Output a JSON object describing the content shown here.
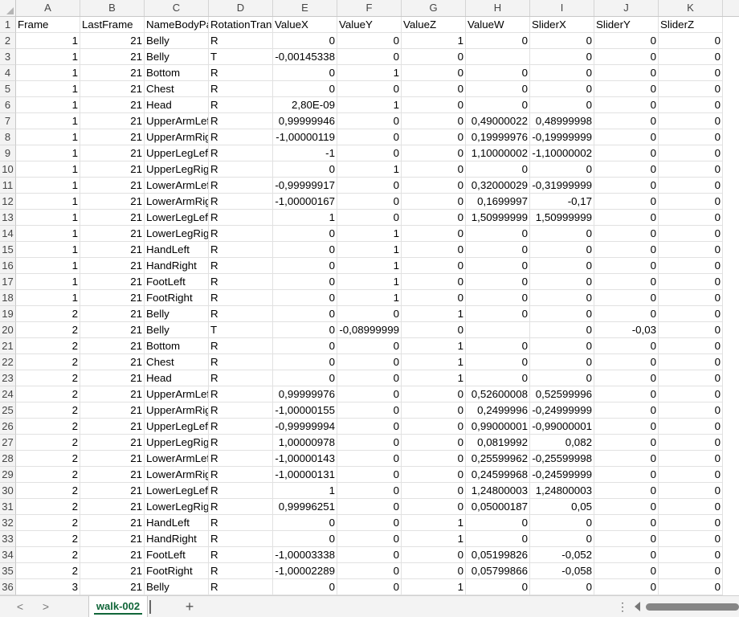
{
  "columns": [
    {
      "letter": "A"
    },
    {
      "letter": "B"
    },
    {
      "letter": "C"
    },
    {
      "letter": "D"
    },
    {
      "letter": "E"
    },
    {
      "letter": "F"
    },
    {
      "letter": "G"
    },
    {
      "letter": "H"
    },
    {
      "letter": "I"
    },
    {
      "letter": "J"
    },
    {
      "letter": "K"
    }
  ],
  "rows": [
    {
      "n": "1",
      "c": [
        "Frame",
        "LastFrame",
        "NameBodyPart",
        "RotationTranslation",
        "ValueX",
        "ValueY",
        "ValueZ",
        "ValueW",
        "SliderX",
        "SliderY",
        "SliderZ"
      ]
    },
    {
      "n": "2",
      "c": [
        "1",
        "21",
        "Belly",
        "R",
        "0",
        "0",
        "1",
        "0",
        "0",
        "0",
        "0"
      ]
    },
    {
      "n": "3",
      "c": [
        "1",
        "21",
        "Belly",
        "T",
        "-0,00145338",
        "0",
        "0",
        "",
        "0",
        "0",
        "0"
      ]
    },
    {
      "n": "4",
      "c": [
        "1",
        "21",
        "Bottom",
        "R",
        "0",
        "1",
        "0",
        "0",
        "0",
        "0",
        "0"
      ]
    },
    {
      "n": "5",
      "c": [
        "1",
        "21",
        "Chest",
        "R",
        "0",
        "0",
        "0",
        "0",
        "0",
        "0",
        "0"
      ]
    },
    {
      "n": "6",
      "c": [
        "1",
        "21",
        "Head",
        "R",
        "2,80E-09",
        "1",
        "0",
        "0",
        "0",
        "0",
        "0"
      ]
    },
    {
      "n": "7",
      "c": [
        "1",
        "21",
        "UpperArmLeft",
        "R",
        "0,99999946",
        "0",
        "0",
        "0,49000022",
        "0,48999998",
        "0",
        "0"
      ]
    },
    {
      "n": "8",
      "c": [
        "1",
        "21",
        "UpperArmRight",
        "R",
        "-1,00000119",
        "0",
        "0",
        "0,19999976",
        "-0,19999999",
        "0",
        "0"
      ]
    },
    {
      "n": "9",
      "c": [
        "1",
        "21",
        "UpperLegLeft",
        "R",
        "-1",
        "0",
        "0",
        "1,10000002",
        "-1,10000002",
        "0",
        "0"
      ]
    },
    {
      "n": "10",
      "c": [
        "1",
        "21",
        "UpperLegRight",
        "R",
        "0",
        "1",
        "0",
        "0",
        "0",
        "0",
        "0"
      ]
    },
    {
      "n": "11",
      "c": [
        "1",
        "21",
        "LowerArmLeft",
        "R",
        "-0,99999917",
        "0",
        "0",
        "0,32000029",
        "-0,31999999",
        "0",
        "0"
      ]
    },
    {
      "n": "12",
      "c": [
        "1",
        "21",
        "LowerArmRight",
        "R",
        "-1,00000167",
        "0",
        "0",
        "0,1699997",
        "-0,17",
        "0",
        "0"
      ]
    },
    {
      "n": "13",
      "c": [
        "1",
        "21",
        "LowerLegLeft",
        "R",
        "1",
        "0",
        "0",
        "1,50999999",
        "1,50999999",
        "0",
        "0"
      ]
    },
    {
      "n": "14",
      "c": [
        "1",
        "21",
        "LowerLegRight",
        "R",
        "0",
        "1",
        "0",
        "0",
        "0",
        "0",
        "0"
      ]
    },
    {
      "n": "15",
      "c": [
        "1",
        "21",
        "HandLeft",
        "R",
        "0",
        "1",
        "0",
        "0",
        "0",
        "0",
        "0"
      ]
    },
    {
      "n": "16",
      "c": [
        "1",
        "21",
        "HandRight",
        "R",
        "0",
        "1",
        "0",
        "0",
        "0",
        "0",
        "0"
      ]
    },
    {
      "n": "17",
      "c": [
        "1",
        "21",
        "FootLeft",
        "R",
        "0",
        "1",
        "0",
        "0",
        "0",
        "0",
        "0"
      ]
    },
    {
      "n": "18",
      "c": [
        "1",
        "21",
        "FootRight",
        "R",
        "0",
        "1",
        "0",
        "0",
        "0",
        "0",
        "0"
      ]
    },
    {
      "n": "19",
      "c": [
        "2",
        "21",
        "Belly",
        "R",
        "0",
        "0",
        "1",
        "0",
        "0",
        "0",
        "0"
      ]
    },
    {
      "n": "20",
      "c": [
        "2",
        "21",
        "Belly",
        "T",
        "0",
        "-0,08999999",
        "0",
        "",
        "0",
        "-0,03",
        "0"
      ]
    },
    {
      "n": "21",
      "c": [
        "2",
        "21",
        "Bottom",
        "R",
        "0",
        "0",
        "1",
        "0",
        "0",
        "0",
        "0"
      ]
    },
    {
      "n": "22",
      "c": [
        "2",
        "21",
        "Chest",
        "R",
        "0",
        "0",
        "1",
        "0",
        "0",
        "0",
        "0"
      ]
    },
    {
      "n": "23",
      "c": [
        "2",
        "21",
        "Head",
        "R",
        "0",
        "0",
        "1",
        "0",
        "0",
        "0",
        "0"
      ]
    },
    {
      "n": "24",
      "c": [
        "2",
        "21",
        "UpperArmLeft",
        "R",
        "0,99999976",
        "0",
        "0",
        "0,52600008",
        "0,52599996",
        "0",
        "0"
      ]
    },
    {
      "n": "25",
      "c": [
        "2",
        "21",
        "UpperArmRight",
        "R",
        "-1,00000155",
        "0",
        "0",
        "0,2499996",
        "-0,24999999",
        "0",
        "0"
      ]
    },
    {
      "n": "26",
      "c": [
        "2",
        "21",
        "UpperLegLeft",
        "R",
        "-0,99999994",
        "0",
        "0",
        "0,99000001",
        "-0,99000001",
        "0",
        "0"
      ]
    },
    {
      "n": "27",
      "c": [
        "2",
        "21",
        "UpperLegRight",
        "R",
        "1,00000978",
        "0",
        "0",
        "0,0819992",
        "0,082",
        "0",
        "0"
      ]
    },
    {
      "n": "28",
      "c": [
        "2",
        "21",
        "LowerArmLeft",
        "R",
        "-1,00000143",
        "0",
        "0",
        "0,25599962",
        "-0,25599998",
        "0",
        "0"
      ]
    },
    {
      "n": "29",
      "c": [
        "2",
        "21",
        "LowerArmRight",
        "R",
        "-1,00000131",
        "0",
        "0",
        "0,24599968",
        "-0,24599999",
        "0",
        "0"
      ]
    },
    {
      "n": "30",
      "c": [
        "2",
        "21",
        "LowerLegLeft",
        "R",
        "1",
        "0",
        "0",
        "1,24800003",
        "1,24800003",
        "0",
        "0"
      ]
    },
    {
      "n": "31",
      "c": [
        "2",
        "21",
        "LowerLegRight",
        "R",
        "0,99996251",
        "0",
        "0",
        "0,05000187",
        "0,05",
        "0",
        "0"
      ]
    },
    {
      "n": "32",
      "c": [
        "2",
        "21",
        "HandLeft",
        "R",
        "0",
        "0",
        "1",
        "0",
        "0",
        "0",
        "0"
      ]
    },
    {
      "n": "33",
      "c": [
        "2",
        "21",
        "HandRight",
        "R",
        "0",
        "0",
        "1",
        "0",
        "0",
        "0",
        "0"
      ]
    },
    {
      "n": "34",
      "c": [
        "2",
        "21",
        "FootLeft",
        "R",
        "-1,00003338",
        "0",
        "0",
        "0,05199826",
        "-0,052",
        "0",
        "0"
      ]
    },
    {
      "n": "35",
      "c": [
        "2",
        "21",
        "FootRight",
        "R",
        "-1,00002289",
        "0",
        "0",
        "0,05799866",
        "-0,058",
        "0",
        "0"
      ]
    },
    {
      "n": "36",
      "c": [
        "3",
        "21",
        "Belly",
        "R",
        "0",
        "0",
        "1",
        "0",
        "0",
        "0",
        "0"
      ]
    }
  ],
  "tabs": {
    "prev_icon": "chevron-left-icon",
    "next_icon": "chevron-right-icon",
    "prev_glyph": "<",
    "next_glyph": ">",
    "active_sheet": "walk-002",
    "add_glyph": "+",
    "more_glyph": "⋮"
  },
  "colors": {
    "accent": "#116639"
  }
}
